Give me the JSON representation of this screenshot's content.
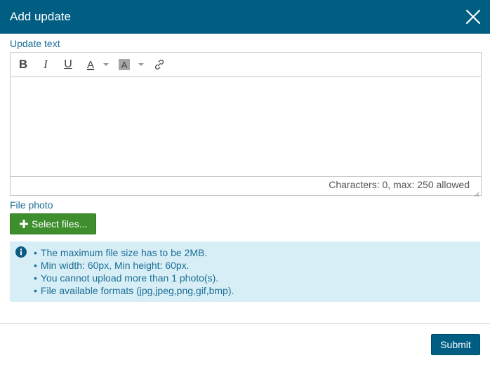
{
  "dialog": {
    "title": "Add update",
    "close_icon": "close-icon"
  },
  "form": {
    "update_text_label": "Update text",
    "toolbar": {
      "bold": "B",
      "italic": "I",
      "underline": "U",
      "fore_color": "A",
      "back_color": "A",
      "link_icon": "link-icon"
    },
    "editor_value": "",
    "char_count": "Characters: 0, max: 250 allowed",
    "file_photo_label": "File photo",
    "select_files_label": "Select files...",
    "info": {
      "icon": "info-icon",
      "items": [
        "The maximum file size has to be 2MB.",
        "Min width: 60px, Min height: 60px.",
        "You cannot upload more than 1 photo(s).",
        "File available formats (jpg,jpeg,png,gif,bmp)."
      ]
    },
    "submit_label": "Submit"
  },
  "colors": {
    "header": "#005e83",
    "label": "#1b6f95",
    "select_button": "#3e8e2d",
    "info_background": "#d8eef6",
    "submit_button": "#005e83"
  }
}
